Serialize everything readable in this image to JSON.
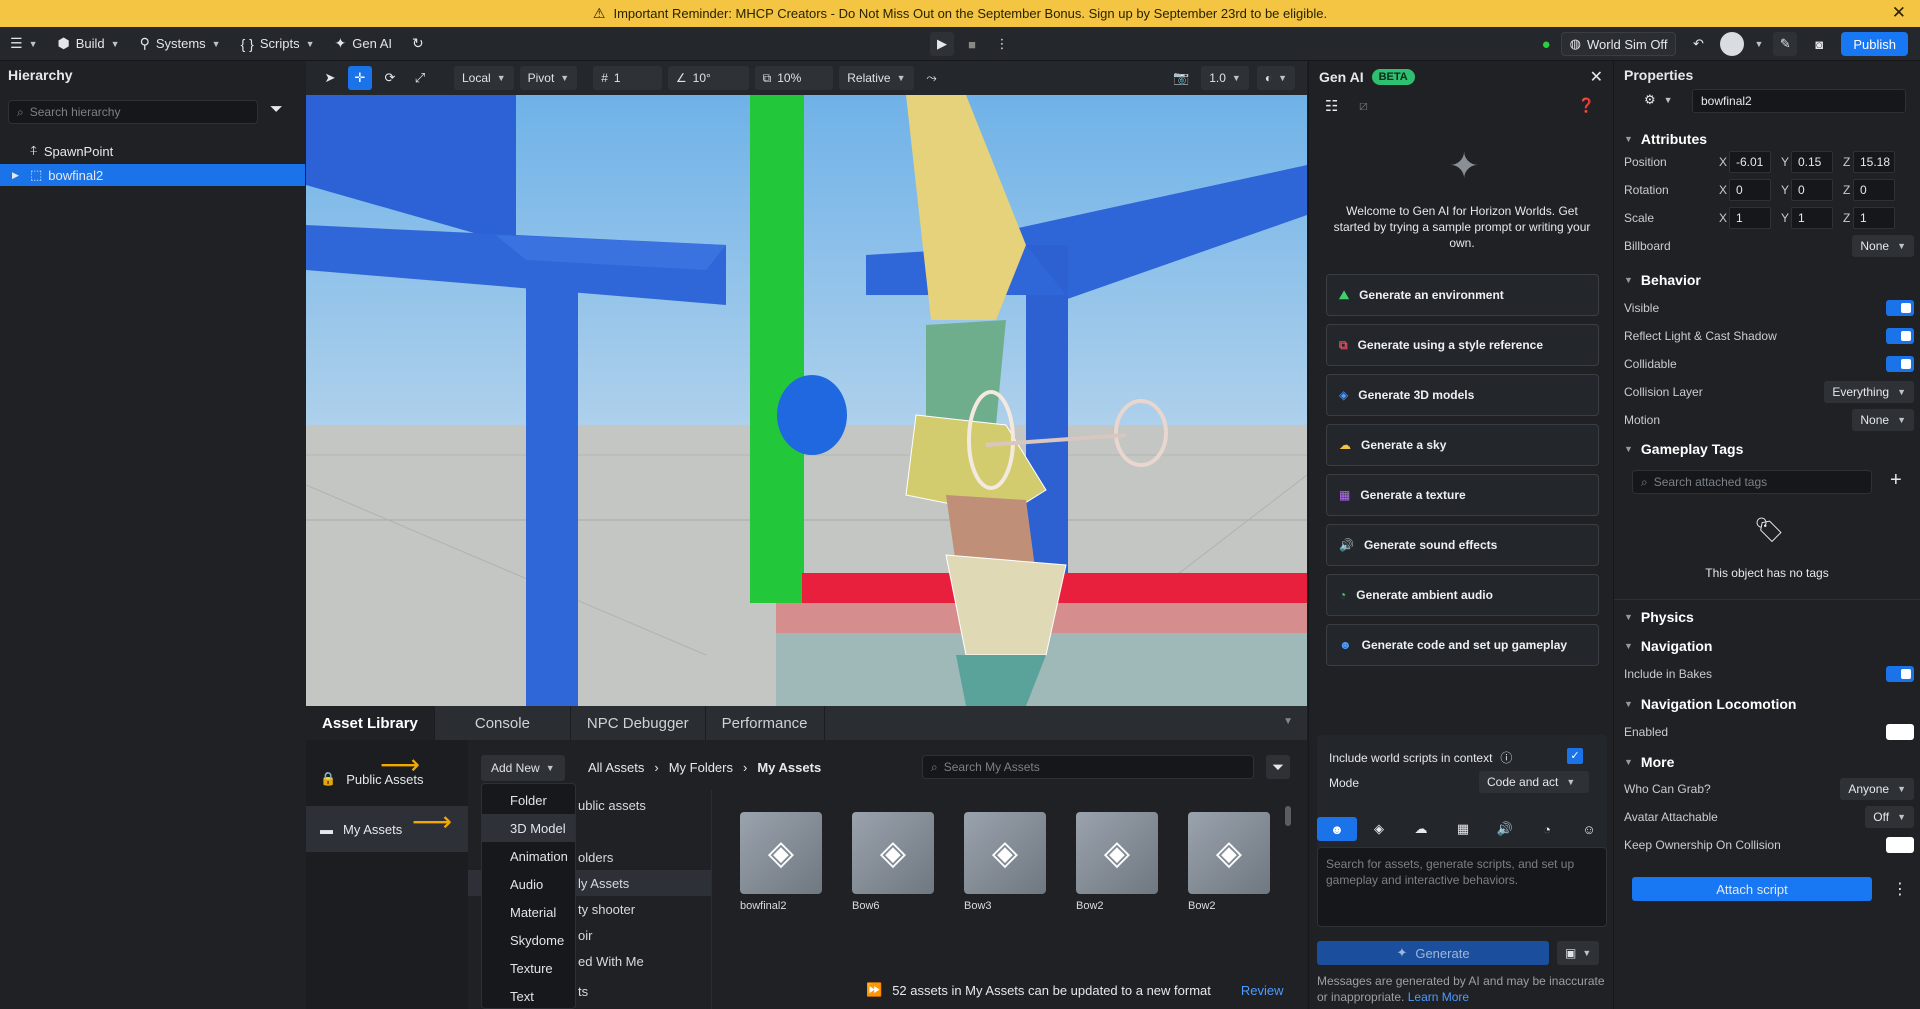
{
  "banner": {
    "text": "Important Reminder: MHCP Creators - Do Not Miss Out on the September Bonus. Sign up by September 23rd to be eligible."
  },
  "topbar": {
    "build": "Build",
    "systems": "Systems",
    "scripts": "Scripts",
    "genai": "Gen AI",
    "world_sim": "World Sim Off",
    "publish": "Publish"
  },
  "hierarchy": {
    "title": "Hierarchy",
    "search_placeholder": "Search hierarchy",
    "items": [
      {
        "label": "SpawnPoint"
      },
      {
        "label": "bowfinal2"
      }
    ]
  },
  "viewport_toolbar": {
    "space": "Local",
    "pivot": "Pivot",
    "grid_value": "1",
    "angle_value": "10°",
    "scale_value": "10%",
    "relative": "Relative",
    "camera_speed": "1.0"
  },
  "bottom_tabs": [
    "Asset Library",
    "Console",
    "NPC Debugger",
    "Performance"
  ],
  "asset_library": {
    "public_assets": "Public Assets",
    "my_assets": "My Assets",
    "add_new": "Add New",
    "breadcrumb": [
      "All Assets",
      "My Folders",
      "My Assets"
    ],
    "search_placeholder": "Search My Assets",
    "folders": [
      "ublic assets",
      "olders",
      "ly Assets",
      "ty shooter",
      "oir",
      "ed With Me",
      "ts"
    ],
    "dropdown": [
      "Folder",
      "3D Model",
      "Animation",
      "Audio",
      "Material",
      "Skydome",
      "Texture",
      "Text"
    ],
    "cards": [
      {
        "label": "bowfinal2"
      },
      {
        "label": "Bow6"
      },
      {
        "label": "Bow3"
      },
      {
        "label": "Bow2"
      },
      {
        "label": "Bow2"
      }
    ],
    "update_notice": "52 assets in My Assets can be updated to a new format",
    "review": "Review"
  },
  "genai": {
    "title": "Gen AI",
    "badge": "BETA",
    "welcome": "Welcome to Gen AI for Horizon Worlds. Get started by trying a sample prompt or writing your own.",
    "actions": [
      "Generate an environment",
      "Generate using a style reference",
      "Generate 3D models",
      "Generate a sky",
      "Generate a texture",
      "Generate sound effects",
      "Generate ambient audio",
      "Generate code and set up gameplay"
    ],
    "include_scripts": "Include world scripts in context",
    "mode_label": "Mode",
    "mode_value": "Code and act",
    "prompt_placeholder": "Search for assets, generate scripts, and set up gameplay and interactive behaviors.",
    "generate": "Generate",
    "disclaimer": "Messages are generated by AI and may be inaccurate or inappropriate.",
    "learn_more": "Learn More"
  },
  "properties": {
    "title": "Properties",
    "name": "bowfinal2",
    "attributes": "Attributes",
    "position": {
      "label": "Position",
      "x": "-6.01",
      "y": "0.15",
      "z": "15.18"
    },
    "rotation": {
      "label": "Rotation",
      "x": "0",
      "y": "0",
      "z": "0"
    },
    "scale": {
      "label": "Scale",
      "x": "1",
      "y": "1",
      "z": "1"
    },
    "billboard": {
      "label": "Billboard",
      "value": "None"
    },
    "behavior": "Behavior",
    "visible": "Visible",
    "reflect": "Reflect Light & Cast Shadow",
    "collidable": "Collidable",
    "collision_layer": {
      "label": "Collision Layer",
      "value": "Everything"
    },
    "motion": {
      "label": "Motion",
      "value": "None"
    },
    "gameplay_tags": "Gameplay Tags",
    "tags_search": "Search attached tags",
    "no_tags": "This object has no tags",
    "physics": "Physics",
    "navigation": "Navigation",
    "include_bakes": "Include in Bakes",
    "nav_locomotion": "Navigation Locomotion",
    "enabled": "Enabled",
    "more": "More",
    "who_can_grab": {
      "label": "Who Can Grab?",
      "value": "Anyone"
    },
    "avatar_attachable": {
      "label": "Avatar Attachable",
      "value": "Off"
    },
    "keep_ownership": "Keep Ownership On Collision",
    "attach_script": "Attach script"
  },
  "colors": {
    "accent": "#1877f2",
    "banner": "#f4c542",
    "annotation": "#f2a900"
  }
}
